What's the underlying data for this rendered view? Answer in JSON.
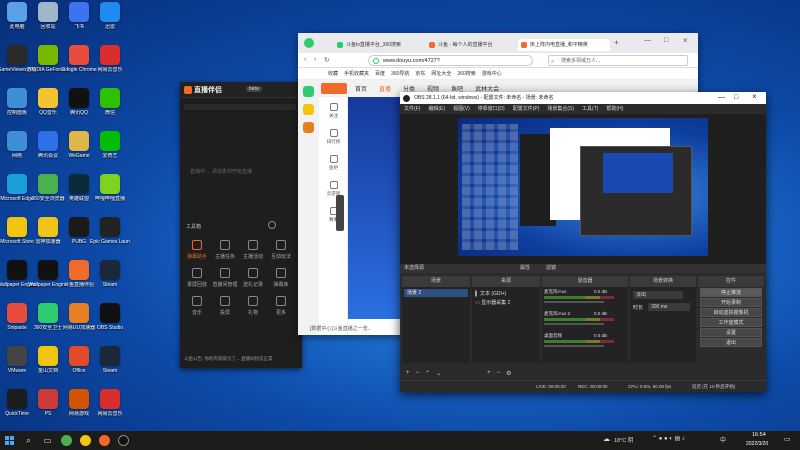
{
  "desktop_icons": [
    {
      "label": "此电脑",
      "color": "#5aa0e8"
    },
    {
      "label": "回收站",
      "color": "#9fb6c9"
    },
    {
      "label": "飞书",
      "color": "#3b73f0"
    },
    {
      "label": "迅雷",
      "color": "#1f8af0"
    },
    {
      "label": "GameViewer远程",
      "color": "#2a2a2a"
    },
    {
      "label": "NVIDIA GeForce Experience",
      "color": "#76b900"
    },
    {
      "label": "Google Chrome",
      "color": "#e74c3c"
    },
    {
      "label": "网易云音乐",
      "color": "#d92e2e"
    },
    {
      "label": "控制面板",
      "color": "#3f8fd6"
    },
    {
      "label": "QQ音乐",
      "color": "#f4c430"
    },
    {
      "label": "腾讯QQ",
      "color": "#111111"
    },
    {
      "label": "微信",
      "color": "#2dc100"
    },
    {
      "label": "网络",
      "color": "#3f8fd6"
    },
    {
      "label": "腾讯会议",
      "color": "#2f6fe8"
    },
    {
      "label": "WeGame",
      "color": "#e0b64a"
    },
    {
      "label": "爱奇艺",
      "color": "#00be06"
    },
    {
      "label": "Microsoft Edge",
      "color": "#1aa0d8"
    },
    {
      "label": "360安全浏览器",
      "color": "#4caf50"
    },
    {
      "label": "英雄联盟",
      "color": "#0b2b3a"
    },
    {
      "label": "哔哩哔哩直播",
      "color": "#7ed321"
    },
    {
      "label": "Microsoft Store",
      "color": "#f1c40f"
    },
    {
      "label": "雷神加速器",
      "color": "#f0c419"
    },
    {
      "label": "PUBG",
      "color": "#1a1a1a"
    },
    {
      "label": "Epic Games Launcher",
      "color": "#222222"
    },
    {
      "label": "Wallpaper Engine",
      "color": "#111111"
    },
    {
      "label": "Wallpaper Engine",
      "color": "#111111"
    },
    {
      "label": "斗鱼直播伴侣",
      "color": "#f06a2a"
    },
    {
      "label": "Steam",
      "color": "#1b2838"
    },
    {
      "label": "Snipaste",
      "color": "#e74c3c"
    },
    {
      "label": "360安全卫士",
      "color": "#2ecc71"
    },
    {
      "label": "网易UU加速器",
      "color": "#e67e22"
    },
    {
      "label": "OBS Studio",
      "color": "#111111"
    },
    {
      "label": "VMware",
      "color": "#444444"
    },
    {
      "label": "金山文档",
      "color": "#f1c40f"
    },
    {
      "label": "Office",
      "color": "#e24a2a"
    },
    {
      "label": "Steam",
      "color": "#1b2838"
    },
    {
      "label": "QuickTime",
      "color": "#1c1c1c"
    },
    {
      "label": "PS",
      "color": "#cc3a3a"
    },
    {
      "label": "网易游戏",
      "color": "#d35400"
    },
    {
      "label": "网易云音乐",
      "color": "#d92e2e"
    }
  ],
  "live_companion": {
    "title": "直播伴侣",
    "badge": "beta",
    "placeholder_text": "直播中 ... 添加素材开始直播",
    "tools_label": "工具箱",
    "tools": [
      "弹幕助手",
      "主播任务",
      "主播活动",
      "互动玩法",
      "录屏回放",
      "直播间管理",
      "送礼记录",
      "弹幕库",
      "音乐",
      "投屏",
      "礼物",
      "更多"
    ],
    "footer_text": "斗鱼公告: 你的内容吸引了... 直播间状态正常"
  },
  "browser": {
    "tabs": [
      {
        "title": "斗鱼tv直播平台_360搜索",
        "color": "#2ecc71"
      },
      {
        "title": "斗鱼 - 每个人的直播平台",
        "color": "#f06a2a"
      },
      {
        "title": "床上阵内电直播_和平精英",
        "color": "#f06a2a"
      }
    ],
    "url": "www.douyu.com/4727?",
    "search_placeholder": "搜索多领域万人...",
    "bookmarks": [
      "收藏",
      "手机收藏夹",
      "百度",
      "360导航",
      "京东",
      "网址大全",
      "360搜索",
      "游戏中心"
    ],
    "site_nav": [
      "首页",
      "直播",
      "分类",
      "视频",
      "鱼吧",
      "武林大会"
    ],
    "left_nav": [
      "关注",
      "排行榜",
      "鱼吧",
      "云游戏",
      "赛事"
    ],
    "notice": "[数据中心]斗鱼直播之一览.."
  },
  "obs": {
    "title": "OBS 28.1.1 (64-bit, windows) - 配置文件: 未命名 - 场景: 未命名",
    "menu": [
      "文件(F)",
      "编辑(E)",
      "视图(V)",
      "停靠窗口(D)",
      "配置文件(P)",
      "场景集合(S)",
      "工具(T)",
      "帮助(H)"
    ],
    "status_tabs": [
      "未选择源",
      "属性",
      "滤镜"
    ],
    "docks": [
      "场景",
      "来源",
      "混音器",
      "场景转换",
      "控件"
    ],
    "scenes": [
      "场景 2"
    ],
    "sources": [
      "文本 (GDI+)",
      "显示器采集 2"
    ],
    "mixer": [
      {
        "name": "麦克风/Aux",
        "db": "0.0 dB",
        "level": 0.6
      },
      {
        "name": "麦克风/Aux 2",
        "db": "0.0 dB",
        "level": 0.55
      },
      {
        "name": "桌面音频",
        "db": "0.0 dB",
        "level": 0.5
      }
    ],
    "transition": {
      "type": "淡出",
      "duration_label": "时长",
      "duration": "300 ms"
    },
    "controls": [
      "停止推流",
      "开始录制",
      "启动虚拟摄像机",
      "工作室模式",
      "设置",
      "退出"
    ],
    "status": {
      "live": "LIVE: 00:00:00",
      "rec": "REC: 00:00:00",
      "cpu": "CPU: 0.5%, 60.00 fps",
      "delay": "延迟 (在 10 秒后开始)"
    }
  },
  "taskbar": {
    "weather": "18°C 阴",
    "time": "16:54",
    "date": "2022/3/20"
  }
}
